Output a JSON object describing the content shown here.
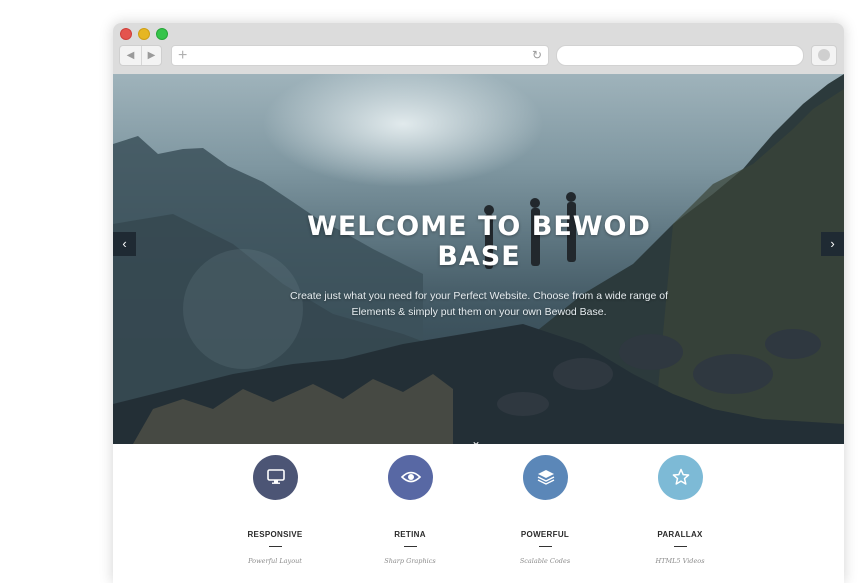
{
  "browser": {
    "back_icon": "◀",
    "forward_icon": "▶",
    "new_tab_icon": "+",
    "reload_icon": "↻",
    "url": "",
    "search": ""
  },
  "hero": {
    "title": "WELCOME TO BEWOD BASE",
    "subtitle": "Create just what you need for your Perfect Website. Choose from a wide range of Elements & simply put them on your own Bewod Base.",
    "prev_icon": "‹",
    "next_icon": "›",
    "scroll_icon": "⌄"
  },
  "features": [
    {
      "title": "RESPONSIVE",
      "subtitle": "Powerful Layout",
      "icon": "monitor-icon",
      "color": "#4c5575"
    },
    {
      "title": "RETINA",
      "subtitle": "Sharp Graphics",
      "icon": "eye-icon",
      "color": "#5868a4"
    },
    {
      "title": "POWERFUL",
      "subtitle": "Scalable Codes",
      "icon": "layers-icon",
      "color": "#5b87b8"
    },
    {
      "title": "PARALLAX",
      "subtitle": "HTML5 Videos",
      "icon": "star-icon",
      "color": "#7dbad6"
    }
  ]
}
